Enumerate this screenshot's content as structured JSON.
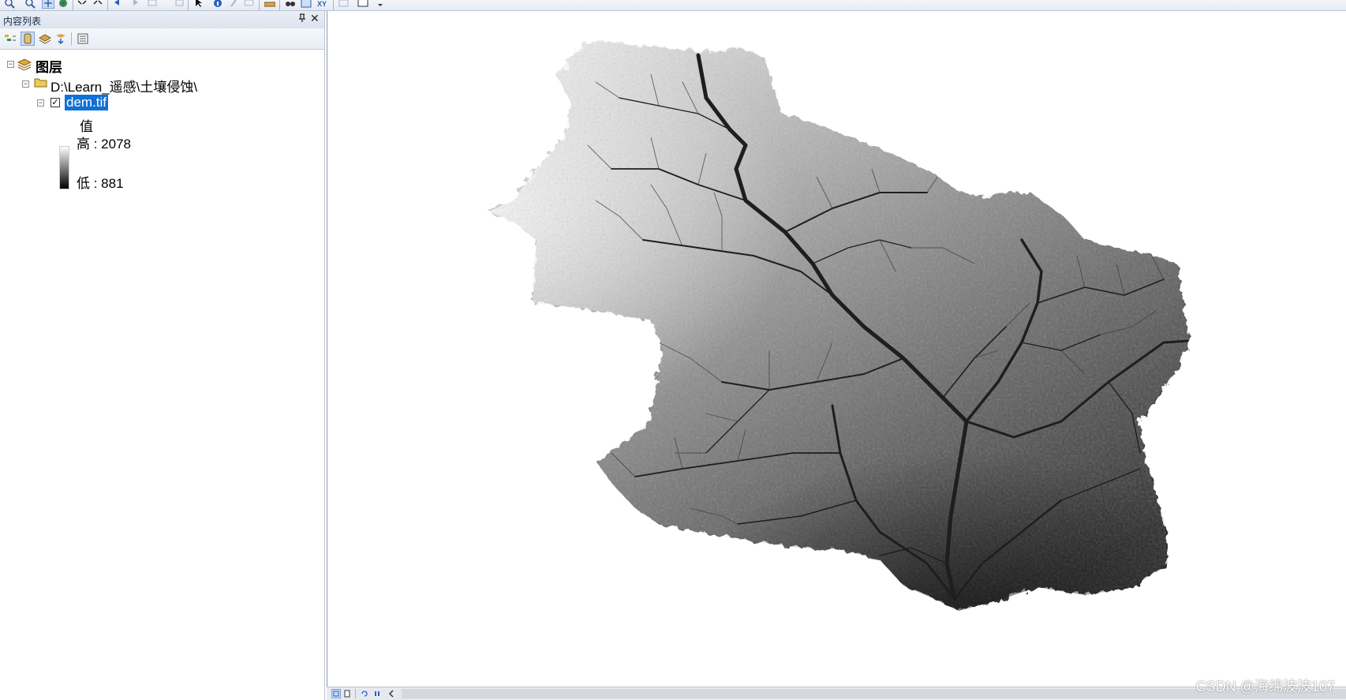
{
  "toc_panel": {
    "title": "内容列表",
    "pin_icon": "pin-icon",
    "close_icon": "close-icon"
  },
  "tree": {
    "root_label": "图层",
    "folder_label": "D:\\Learn_遥感\\土壤侵蚀\\",
    "layer_label": "dem.tif",
    "layer_checked": true,
    "legend": {
      "field_label": "值",
      "high_label": "高 : 2078",
      "low_label": "低 : 881",
      "high_color": "#ffffff",
      "low_color": "#000000"
    }
  },
  "watermark": "CSDN @海绵波波107",
  "colors": {
    "selection": "#1070d6",
    "panel_border": "#b9c3d3"
  }
}
